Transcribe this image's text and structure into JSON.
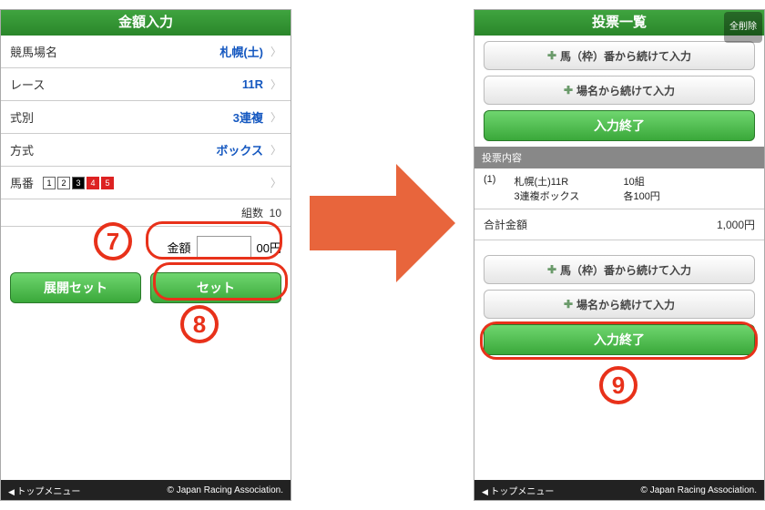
{
  "left": {
    "title": "金額入力",
    "rows": {
      "track_label": "競馬場名",
      "track_value": "札幌(土)",
      "race_label": "レース",
      "race_value": "11R",
      "type_label": "式別",
      "type_value": "3連複",
      "method_label": "方式",
      "method_value": "ボックス",
      "horse_label": "馬番"
    },
    "horses": [
      "1",
      "2",
      "3",
      "4",
      "5"
    ],
    "kumi_label": "組数",
    "kumi_value": "10",
    "amount_label": "金額",
    "amount_suffix": "00円",
    "expand_btn": "展開セット",
    "set_btn": "セット",
    "footer_left": "トップメニュー",
    "footer_right": "© Japan Racing Association."
  },
  "right": {
    "title": "投票一覧",
    "delete_all": "全削除",
    "btn_horse": "馬（枠）番から続けて入力",
    "btn_place": "場名から続けて入力",
    "btn_finish": "入力終了",
    "section": "投票内容",
    "ticket": {
      "idx": "(1)",
      "line1a": "札幌(土)11R",
      "line1b": "10組",
      "line2a": "3連複ボックス",
      "line2b": "各100円"
    },
    "total_label": "合計金額",
    "total_value": "1,000円",
    "footer_left": "トップメニュー",
    "footer_right": "© Japan Racing Association."
  },
  "nums": {
    "n7": "7",
    "n8": "8",
    "n9": "9"
  }
}
